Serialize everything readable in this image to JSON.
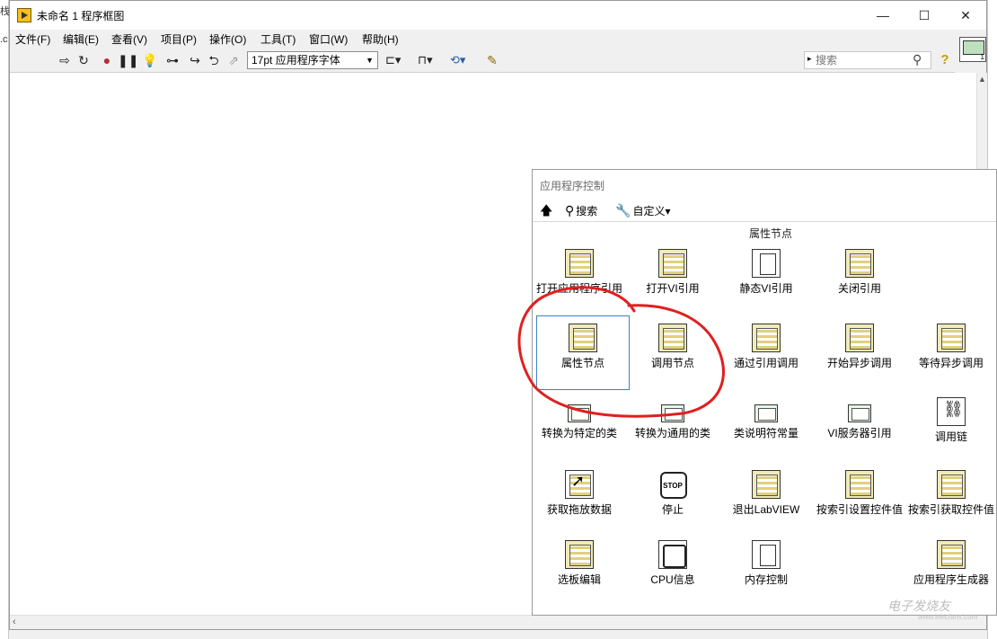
{
  "window": {
    "title": "未命名 1 程序框图"
  },
  "menu": [
    "文件(F)",
    "编辑(E)",
    "查看(V)",
    "项目(P)",
    "操作(O)",
    "工具(T)",
    "窗口(W)",
    "帮助(H)"
  ],
  "toolbar": {
    "font": "17pt 应用程序字体",
    "search_placeholder": "搜索"
  },
  "vi_icon_number": "1",
  "palette": {
    "title": "应用程序控制",
    "tools": {
      "up_label": "",
      "search_label": "搜索",
      "customize_label": "自定义▾"
    },
    "section_title": "属性节点",
    "items": [
      {
        "label": "打开应用程序引用",
        "icon": "open-app-ref-icon"
      },
      {
        "label": "打开VI引用",
        "icon": "open-vi-ref-icon"
      },
      {
        "label": "静态VI引用",
        "icon": "static-vi-ref-icon"
      },
      {
        "label": "关闭引用",
        "icon": "close-ref-icon"
      },
      {
        "label": "属性节点",
        "icon": "property-node-icon"
      },
      {
        "label": "调用节点",
        "icon": "invoke-node-icon"
      },
      {
        "label": "通过引用调用",
        "icon": "call-by-ref-icon"
      },
      {
        "label": "开始异步调用",
        "icon": "start-async-call-icon"
      },
      {
        "label": "等待异步调用",
        "icon": "wait-async-call-icon"
      },
      {
        "label": "转换为特定的类",
        "icon": "to-more-specific-class-icon"
      },
      {
        "label": "转换为通用的类",
        "icon": "to-more-generic-class-icon"
      },
      {
        "label": "类说明符常量",
        "icon": "class-specifier-constant-icon"
      },
      {
        "label": "VI服务器引用",
        "icon": "vi-server-ref-icon"
      },
      {
        "label": "调用链",
        "icon": "call-chain-icon"
      },
      {
        "label": "获取拖放数据",
        "icon": "get-drag-drop-data-icon"
      },
      {
        "label": "停止",
        "icon": "stop-icon"
      },
      {
        "label": "退出LabVIEW",
        "icon": "quit-labview-icon"
      },
      {
        "label": "按索引设置控件值",
        "icon": "set-control-value-by-index-icon"
      },
      {
        "label": "按索引获取控件值",
        "icon": "get-control-value-by-index-icon"
      },
      {
        "label": "选板编辑",
        "icon": "menu-edit-icon"
      },
      {
        "label": "CPU信息",
        "icon": "cpu-info-icon"
      },
      {
        "label": "内存控制",
        "icon": "memory-control-icon"
      },
      {
        "label": "应用程序生成器",
        "icon": "app-builder-icon"
      }
    ],
    "selected_item": "属性节点"
  },
  "annotation_color": "#e02020",
  "watermark": {
    "text": "电子发烧友",
    "url": "www.elecfans.com"
  }
}
